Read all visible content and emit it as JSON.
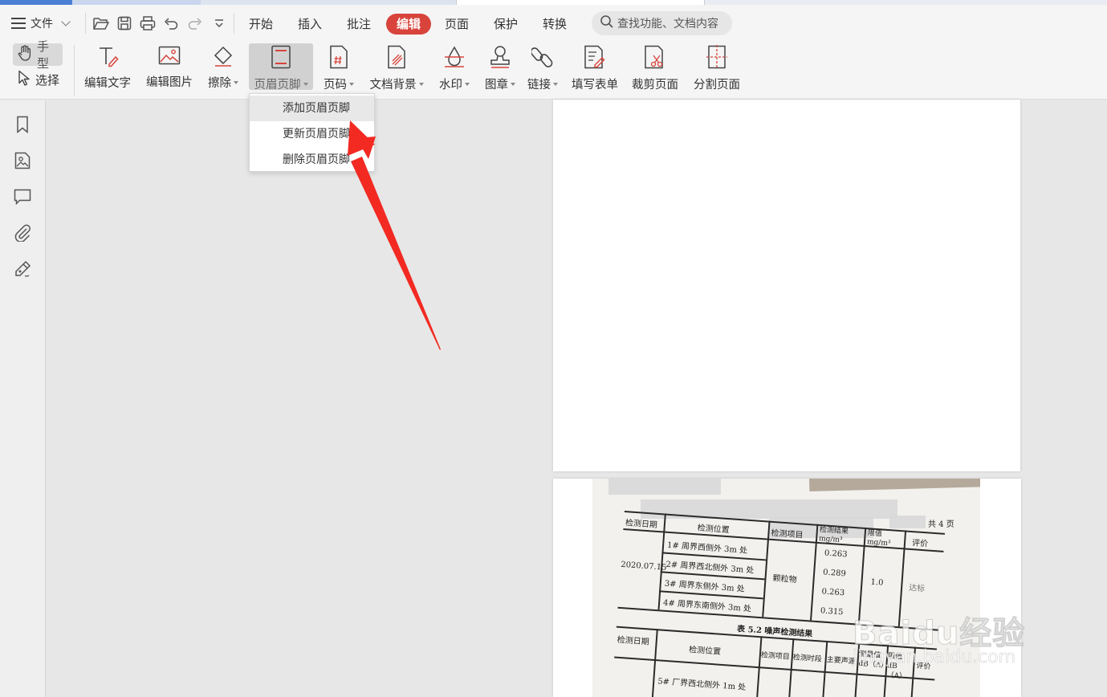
{
  "menubar": {
    "file_label": "文件",
    "tabs": [
      "开始",
      "插入",
      "批注",
      "编辑",
      "页面",
      "保护",
      "转换"
    ],
    "active_tab": "编辑",
    "search_placeholder": "查找功能、文档内容"
  },
  "ribbon": {
    "modes": [
      "手型",
      "选择"
    ],
    "tools": [
      {
        "label": "编辑文字",
        "icon": "edit-text-icon"
      },
      {
        "label": "编辑图片",
        "icon": "edit-image-icon"
      },
      {
        "label": "擦除",
        "icon": "eraser-icon"
      },
      {
        "label": "页眉页脚",
        "icon": "header-footer-icon"
      },
      {
        "label": "页码",
        "icon": "page-number-icon"
      },
      {
        "label": "文档背景",
        "icon": "document-background-icon"
      },
      {
        "label": "水印",
        "icon": "watermark-icon"
      },
      {
        "label": "图章",
        "icon": "stamp-icon"
      },
      {
        "label": "链接",
        "icon": "link-icon"
      },
      {
        "label": "填写表单",
        "icon": "fill-form-icon"
      },
      {
        "label": "裁剪页面",
        "icon": "crop-page-icon"
      },
      {
        "label": "分割页面",
        "icon": "split-page-icon"
      }
    ]
  },
  "dropdown": {
    "items": [
      "添加页眉页脚",
      "更新页眉页脚",
      "删除页眉页脚"
    ]
  },
  "sidebar": {
    "icons": [
      "bookmark-icon",
      "image-icon",
      "comment-icon",
      "attachment-icon",
      "signature-icon"
    ]
  },
  "document": {
    "page_of": "共 4 页",
    "table1": {
      "headers": [
        "检测日期",
        "检测位置",
        "检测项目",
        "检测结果 mg/m³",
        "限值 mg/m³",
        "评价"
      ],
      "date": "2020.07.15",
      "locations": [
        "1# 周界西侧外 3m 处",
        "2# 周界西北侧外 3m 处",
        "3# 周界东侧外 3m 处",
        "4# 周界东南侧外 3m 处"
      ],
      "item": "颗粒物",
      "results": [
        "0.263",
        "0.289",
        "0.263",
        "0.315"
      ],
      "limit": "1.0",
      "evaluation": "达标"
    },
    "table2": {
      "title": "表 5.2  噪声检测结果",
      "headers": [
        "检测日期",
        "检测位置",
        "检测项目",
        "检测时段",
        "主要声源",
        "测量值 dB（A）",
        "限值 dB（A）",
        "评价"
      ],
      "first_row": "5# 厂界西北侧外 1m 处"
    }
  },
  "watermark": {
    "main": "Baidu经验",
    "sub": "jingyan.baidu.com"
  },
  "colors": {
    "accent": "#d8443c",
    "arrow": "#f22a22"
  }
}
